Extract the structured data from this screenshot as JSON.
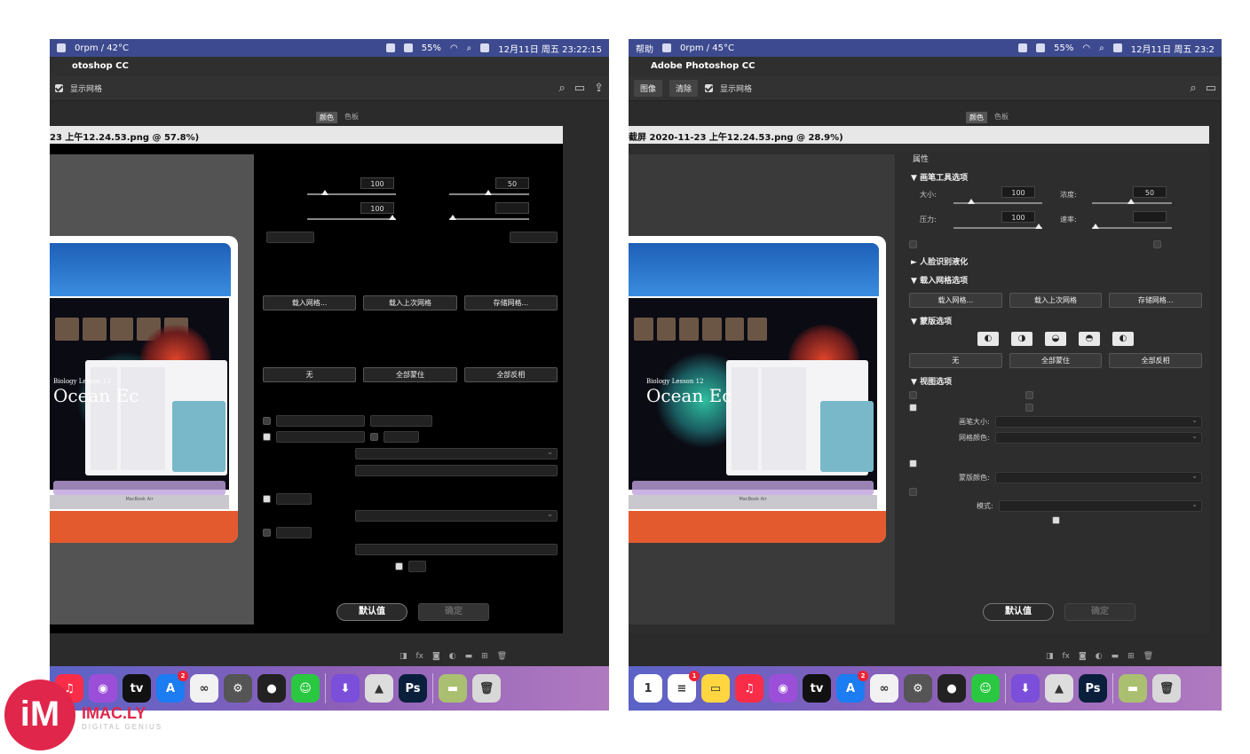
{
  "left": {
    "menubar": {
      "weather": "0rpm / 42°C",
      "battery": "55%",
      "datetime": "12月11日 周五 23:22:15"
    },
    "app_title": "otoshop CC",
    "option_bar": {
      "show_grid": "显示网格"
    },
    "panel_tabs": [
      "颜色",
      "色板"
    ],
    "dialog_title": "23 上午12.24.53.png @ 57.8%)",
    "fields": {
      "size": "100",
      "density": "50",
      "pressure": "100"
    },
    "mesh_buttons": [
      "载入网格...",
      "载入上次网格",
      "存储网格..."
    ],
    "mask_buttons": [
      "无",
      "全部蒙住",
      "全部反相"
    ],
    "footer": {
      "default": "默认值",
      "ok": "确定"
    },
    "photo": {
      "lesson": "Biology Lesson 12",
      "ocean": "Ocean Ec",
      "device": "MacBook Air"
    }
  },
  "right": {
    "menubar": {
      "help": "帮助",
      "weather": "0rpm / 45°C",
      "battery": "55%",
      "datetime": "12月11日 周五 23:2"
    },
    "app_title": "Adobe Photoshop CC",
    "option_bar": {
      "btn1": "图像",
      "btn2": "清除",
      "show_grid": "显示网格"
    },
    "panel_tabs": [
      "颜色",
      "色板"
    ],
    "dialog_title": "截屏 2020-11-23 上午12.24.53.png @ 28.9%)",
    "properties_title": "属性",
    "sections": {
      "brush": "画笔工具选项",
      "face": "人脸识别液化",
      "load_mesh": "载入网格选项",
      "mask": "蒙版选项",
      "view": "视图选项"
    },
    "labels": {
      "size": "大小:",
      "density": "浓度:",
      "pressure": "压力:",
      "rate": "速率:",
      "mask_color": "蒙版颜色:",
      "mode": "模式:",
      "brush_size": "画笔大小:",
      "mesh_color": "网格颜色:"
    },
    "fields": {
      "size": "100",
      "density": "50",
      "pressure": "100"
    },
    "mesh_buttons": [
      "载入网格...",
      "载入上次网格",
      "存储网格..."
    ],
    "mask_icons": [
      "◐",
      "◑",
      "◒",
      "◓",
      "◐"
    ],
    "mask_buttons": [
      "无",
      "全部蒙住",
      "全部反相"
    ],
    "footer": {
      "default": "默认值",
      "ok": "确定"
    },
    "photo": {
      "lesson": "Biology Lesson 12",
      "ocean": "Ocean Ec",
      "device": "MacBook Air"
    }
  },
  "dock_left": [
    {
      "name": "music",
      "glyph": "♫",
      "color": "#fa2d48"
    },
    {
      "name": "podcasts",
      "glyph": "◉",
      "color": "#9b4fd9"
    },
    {
      "name": "tv",
      "glyph": "tv",
      "color": "#111111"
    },
    {
      "name": "app-store",
      "glyph": "A",
      "color": "#1c7cf2",
      "badge": "2"
    },
    {
      "name": "screen-share",
      "glyph": "∞",
      "color": "#f2f2f2"
    },
    {
      "name": "system-prefs",
      "glyph": "⚙",
      "color": "#555555"
    },
    {
      "name": "qq",
      "glyph": "●",
      "color": "#222222"
    },
    {
      "name": "wechat",
      "glyph": "☺",
      "color": "#2ac840"
    },
    {
      "name": "downloads",
      "glyph": "⬇",
      "color": "#7b4fd9"
    },
    {
      "name": "preview",
      "glyph": "▲",
      "color": "#dddddd"
    },
    {
      "name": "photoshop",
      "glyph": "Ps",
      "color": "#0a1f3c"
    },
    {
      "name": "finder-image",
      "glyph": "▬",
      "color": "#aac070"
    },
    {
      "name": "trash",
      "glyph": "🗑",
      "color": "#d8d8d8"
    }
  ],
  "dock_right": [
    {
      "name": "calendar",
      "glyph": "1",
      "color": "#ffffff"
    },
    {
      "name": "reminders",
      "glyph": "≡",
      "color": "#ffffff",
      "badge": "1"
    },
    {
      "name": "notes",
      "glyph": "▭",
      "color": "#ffd640"
    },
    {
      "name": "music",
      "glyph": "♫",
      "color": "#fa2d48"
    },
    {
      "name": "podcasts",
      "glyph": "◉",
      "color": "#9b4fd9"
    },
    {
      "name": "tv",
      "glyph": "tv",
      "color": "#111111"
    },
    {
      "name": "app-store",
      "glyph": "A",
      "color": "#1c7cf2",
      "badge": "2"
    },
    {
      "name": "screen-share",
      "glyph": "∞",
      "color": "#f2f2f2"
    },
    {
      "name": "system-prefs",
      "glyph": "⚙",
      "color": "#555555"
    },
    {
      "name": "qq",
      "glyph": "●",
      "color": "#222222"
    },
    {
      "name": "wechat",
      "glyph": "☺",
      "color": "#2ac840"
    },
    {
      "name": "downloads",
      "glyph": "⬇",
      "color": "#7b4fd9"
    },
    {
      "name": "preview",
      "glyph": "▲",
      "color": "#dddddd"
    },
    {
      "name": "photoshop",
      "glyph": "Ps",
      "color": "#0a1f3c"
    },
    {
      "name": "finder-image",
      "glyph": "▬",
      "color": "#aac070"
    },
    {
      "name": "trash",
      "glyph": "🗑",
      "color": "#d8d8d8"
    }
  ],
  "watermark": {
    "mark": "iM",
    "name": "IMAC.LY",
    "tagline": "DIGITAL GENIUS"
  }
}
